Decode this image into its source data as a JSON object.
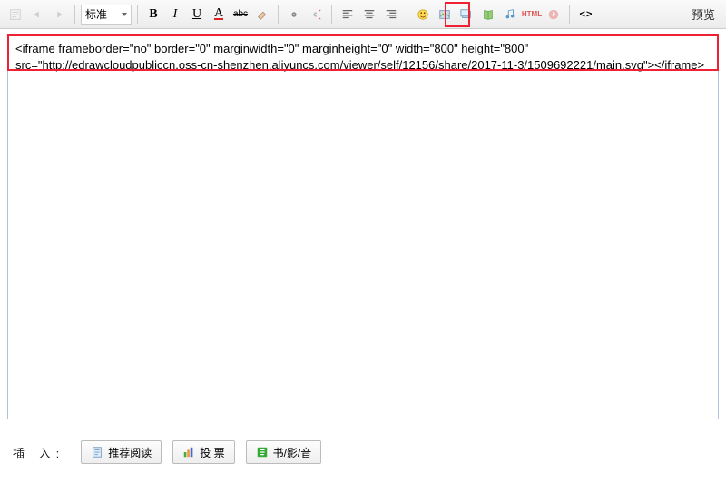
{
  "toolbar": {
    "font_label": "标准",
    "preview": "预览"
  },
  "editor": {
    "content": "<iframe frameborder=\"no\" border=\"0\" marginwidth=\"0\" marginheight=\"0\" width=\"800\" height=\"800\" src=\"http://edrawcloudpubliccn.oss-cn-shenzhen.aliyuncs.com/viewer/self/12156/share/2017-11-3/1509692221/main.svg\"></iframe>"
  },
  "footer": {
    "insert_label": "插 入:",
    "recommend": "推荐阅读",
    "vote": "投 票",
    "book": "书/影/音"
  },
  "icons": {
    "source": "source-icon",
    "cut": "cut-icon",
    "copy": "copy-icon",
    "paste": "paste-icon",
    "bold": "B",
    "italic": "I",
    "underline": "U",
    "color": "A",
    "strike": "abc",
    "clear": "clear",
    "link": "link",
    "unlink": "unlink",
    "alignL": "left",
    "alignC": "center",
    "alignR": "right",
    "emoji": "emoji",
    "image": "image",
    "gallery": "gallery",
    "flash": "flash",
    "music": "music",
    "html": "html",
    "code": "< >"
  }
}
